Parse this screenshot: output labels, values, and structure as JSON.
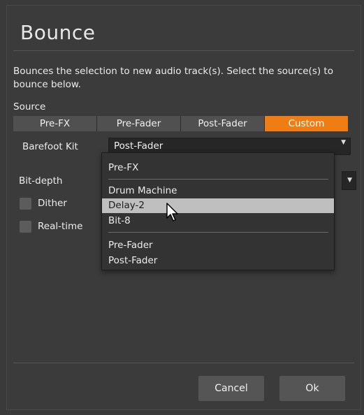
{
  "dialog": {
    "title": "Bounce",
    "description": "Bounces the selection to new audio track(s). Select the source(s) to bounce below."
  },
  "source": {
    "label": "Source",
    "options": [
      "Pre-FX",
      "Pre-Fader",
      "Post-Fader",
      "Custom"
    ],
    "selected": "Custom"
  },
  "track_row": {
    "name": "Barefoot Kit",
    "value": "Post-Fader"
  },
  "bit_depth": {
    "label": "Bit-depth"
  },
  "dither": {
    "label": "Dither",
    "checked": false
  },
  "realtime": {
    "label": "Real-time",
    "checked": false
  },
  "dropdown": {
    "items": [
      "Pre-FX",
      "Drum Machine",
      "Delay-2",
      "Bit-8",
      "Pre-Fader",
      "Post-Fader"
    ],
    "highlighted": "Delay-2"
  },
  "buttons": {
    "cancel": "Cancel",
    "ok": "Ok"
  },
  "colors": {
    "accent": "#f07d14",
    "highlight": "#bfbfbf"
  },
  "icons": {
    "caret": "chevron-down-icon",
    "cursor": "mouse-pointer-icon"
  }
}
